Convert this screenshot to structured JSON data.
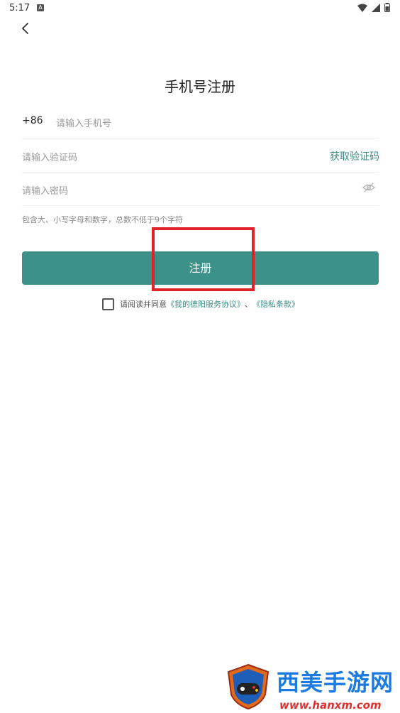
{
  "status": {
    "time": "5:17",
    "a_icon": "A"
  },
  "page": {
    "title": "手机号注册",
    "back_icon": "chevron-left-icon"
  },
  "phone": {
    "country_code": "+86",
    "placeholder": "请输入手机号"
  },
  "code": {
    "placeholder": "请输入验证码",
    "get_code": "获取验证码"
  },
  "password": {
    "placeholder": "请输入密码",
    "eye_icon": "eye-off-icon",
    "hint": "包含大、小写字母和数字，总数不低于9个字符"
  },
  "register": {
    "label": "注册",
    "color": "#3c9189"
  },
  "agreement": {
    "prefix": "请阅读并同意",
    "service": "《我的德阳服务协议》",
    "sep": "、",
    "privacy": "《隐私条款》"
  },
  "watermark": {
    "name": "西美手游网",
    "url": "www.hanxm.com"
  },
  "colors": {
    "accent": "#3d8c85",
    "highlight": "#e0232b"
  }
}
